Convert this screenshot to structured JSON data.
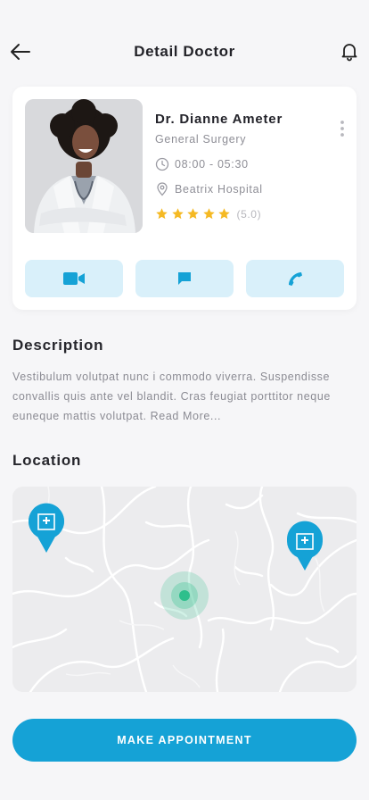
{
  "header": {
    "title": "Detail Doctor",
    "back_icon": "arrow-left-icon",
    "notification_icon": "bell-icon"
  },
  "doctor": {
    "name": "Dr. Dianne Ameter",
    "specialty": "General Surgery",
    "hours": "08:00 - 05:30",
    "hospital": "Beatrix Hospital",
    "rating_value": 5.0,
    "rating_text": "(5.0)",
    "stars_filled": 5,
    "stars_total": 5
  },
  "actions": [
    {
      "name": "video-call",
      "icon": "video-camera-icon"
    },
    {
      "name": "message",
      "icon": "chat-bubble-icon"
    },
    {
      "name": "phone-call",
      "icon": "phone-icon"
    }
  ],
  "description": {
    "title": "Description",
    "text": "Vestibulum volutpat nunc i commodo viverra. Suspendisse convallis quis ante vel blandit. Cras feugiat porttitor neque euneque mattis volutpat. Read More..."
  },
  "location": {
    "title": "Location",
    "markers": [
      "hospital-marker",
      "hospital-marker"
    ],
    "current_location": "current-location-marker"
  },
  "cta": {
    "label": "MAKE APPOINTMENT"
  },
  "colors": {
    "accent": "#15a2d6",
    "accent_light": "#d9f0fa",
    "star": "#f5b923",
    "location_green": "#2ebf8c",
    "background": "#f6f6f8"
  }
}
